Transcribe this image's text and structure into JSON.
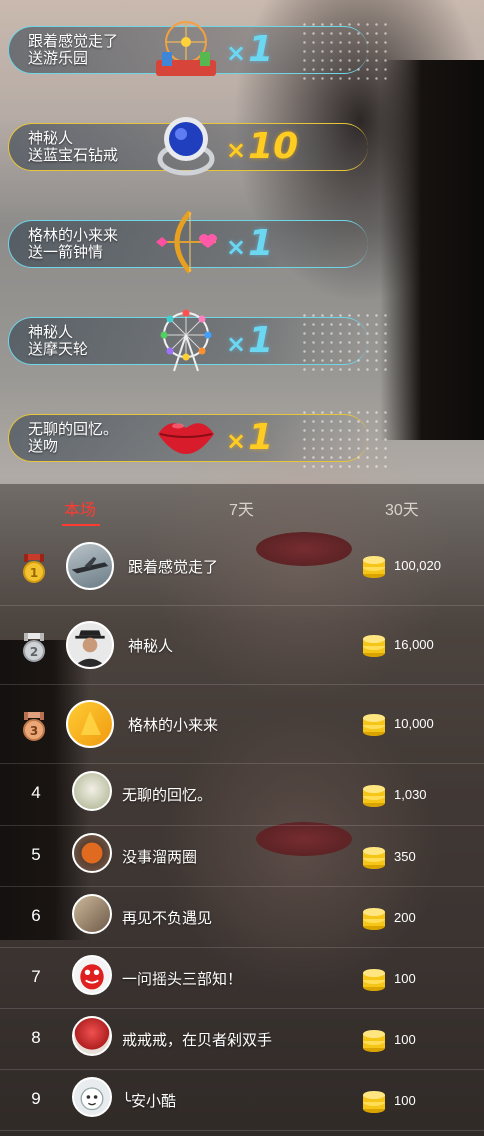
{
  "gifts": [
    {
      "line1": "跟着感觉走了",
      "line2": "送游乐园",
      "mult_x": "×",
      "mult_n": "1",
      "theme": "cyan",
      "icon": "amusement-park-icon"
    },
    {
      "line1": "神秘人",
      "line2": "送蓝宝石钻戒",
      "mult_x": "×",
      "mult_n": "10",
      "theme": "gold",
      "icon": "sapphire-ring-icon"
    },
    {
      "line1": "格林的小来来",
      "line2": "送一箭钟情",
      "mult_x": "×",
      "mult_n": "1",
      "theme": "cyan",
      "icon": "cupid-bow-icon"
    },
    {
      "line1": "神秘人",
      "line2": "送摩天轮",
      "mult_x": "×",
      "mult_n": "1",
      "theme": "cyan",
      "icon": "ferris-wheel-icon"
    },
    {
      "line1": "无聊的回忆。",
      "line2": "送吻",
      "mult_x": "×",
      "mult_n": "1",
      "theme": "gold",
      "icon": "kiss-lips-icon"
    }
  ],
  "tabs": [
    "本场",
    "7天",
    "30天"
  ],
  "active_tab": "本场",
  "ranking": [
    {
      "rank": "1",
      "name": "跟着感觉走了",
      "amount": "100,020",
      "avatar": "airplane-avatar"
    },
    {
      "rank": "2",
      "name": "神秘人",
      "amount": "16,000",
      "avatar": "mystery-man-avatar"
    },
    {
      "rank": "3",
      "name": "格林的小来来",
      "amount": "10,000",
      "avatar": "yellow-avatar"
    },
    {
      "rank": "4",
      "name": "无聊的回忆。",
      "amount": "1,030",
      "avatar": "dog-avatar"
    },
    {
      "rank": "5",
      "name": "没事溜两圈",
      "amount": "350",
      "avatar": "basketball-avatar"
    },
    {
      "rank": "6",
      "name": "再见不负遇见",
      "amount": "200",
      "avatar": "person-avatar"
    },
    {
      "rank": "7",
      "name": "一问摇头三部知！",
      "amount": "100",
      "avatar": "mm-candy-avatar"
    },
    {
      "rank": "8",
      "name": "戒戒戒，在贝者剁双手",
      "amount": "100",
      "avatar": "red-pot-avatar"
    },
    {
      "rank": "9",
      "name": "╰安小酷",
      "amount": "100",
      "avatar": "cartoon-avatar"
    }
  ],
  "colors": {
    "accent_red": "#ff3b30",
    "gift_cyan": "#6cd7f0",
    "gift_gold": "#ffcc22",
    "coin_gold": "#f5c518"
  }
}
